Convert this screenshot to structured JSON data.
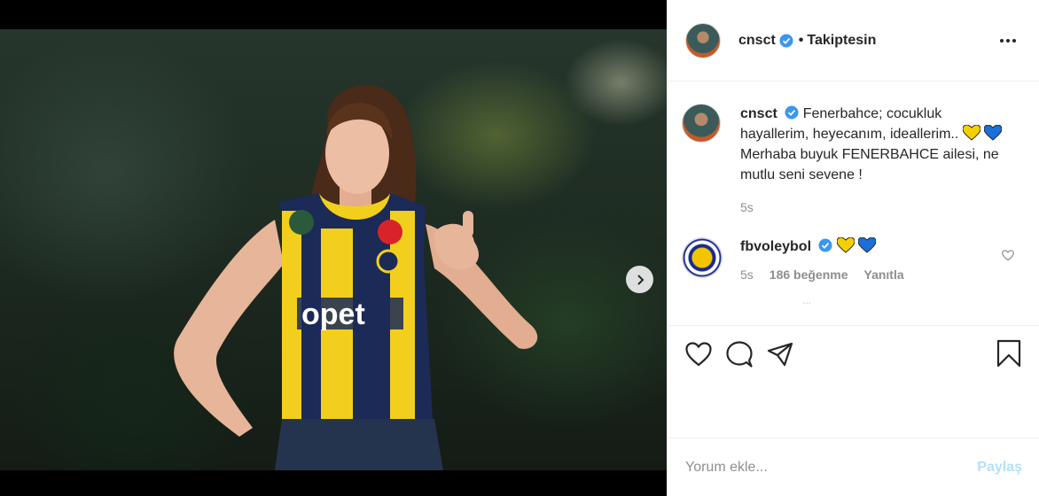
{
  "post": {
    "author": "cnsct",
    "follow_state": "Takiptesin",
    "bullet": "•",
    "colors": {
      "accent": "#0095f6",
      "verified": "#3897f0",
      "yellow": "#f5d000",
      "blue": "#1a6fd8"
    }
  },
  "media": {
    "slide_count": 2,
    "active_slide": 1,
    "next_icon": "chevron-right-icon"
  },
  "caption": {
    "username": "cnsct",
    "text_1": "Fenerbahce; cocukluk hayallerim, heyecanım, ideallerim..",
    "text_2": "Merhaba buyuk FENERBAHCE ailesi, ne mutlu seni sevene !",
    "time": "5s"
  },
  "reply": {
    "username": "fbvoleybol",
    "time": "5s",
    "likes": "186 beğenme",
    "reply_label": "Yanıtla",
    "more": "..."
  },
  "actions": {
    "icons": [
      "heart-icon",
      "comment-icon",
      "share-icon",
      "bookmark-icon"
    ]
  },
  "composer": {
    "placeholder": "Yorum ekle...",
    "post_label": "Paylaş"
  }
}
